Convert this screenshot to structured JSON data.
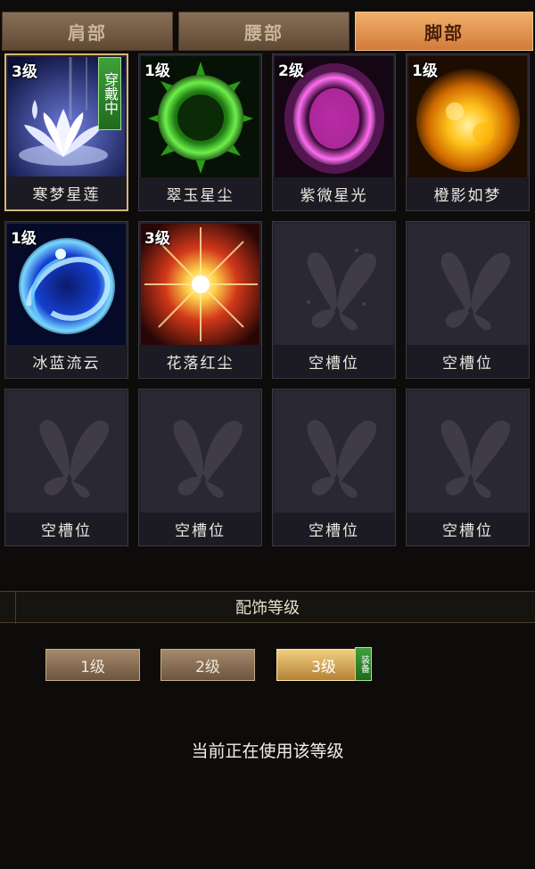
{
  "tabs": [
    {
      "label": "肩部",
      "active": false
    },
    {
      "label": "腰部",
      "active": false
    },
    {
      "label": "脚部",
      "active": true
    }
  ],
  "slots": [
    {
      "level": "3级",
      "name": "寒梦星莲",
      "icon": "lotus-icon",
      "wearing": "穿戴中"
    },
    {
      "level": "1级",
      "name": "翠玉星尘",
      "icon": "green-star-icon"
    },
    {
      "level": "2级",
      "name": "紫微星光",
      "icon": "purple-orb-icon"
    },
    {
      "level": "1级",
      "name": "橙影如梦",
      "icon": "orange-sun-icon"
    },
    {
      "level": "1级",
      "name": "冰蓝流云",
      "icon": "blue-swirl-icon"
    },
    {
      "level": "3级",
      "name": "花落红尘",
      "icon": "red-burst-icon"
    },
    {
      "name": "空槽位",
      "icon": "butterfly-icon"
    },
    {
      "name": "空槽位",
      "icon": "butterfly-icon"
    },
    {
      "name": "空槽位",
      "icon": "butterfly-icon"
    },
    {
      "name": "空槽位",
      "icon": "butterfly-icon"
    },
    {
      "name": "空槽位",
      "icon": "butterfly-icon"
    },
    {
      "name": "空槽位",
      "icon": "butterfly-icon"
    }
  ],
  "accessory_level": {
    "title": "配饰等级",
    "buttons": [
      "1级",
      "2级",
      "3级"
    ],
    "active_button": "3级",
    "equip_tag": "装备",
    "status": "当前正在使用该等级"
  },
  "colors": {
    "tab_active": "#e39450",
    "selected_border": "#d8b676",
    "badge_green": "#2f8a2c"
  }
}
